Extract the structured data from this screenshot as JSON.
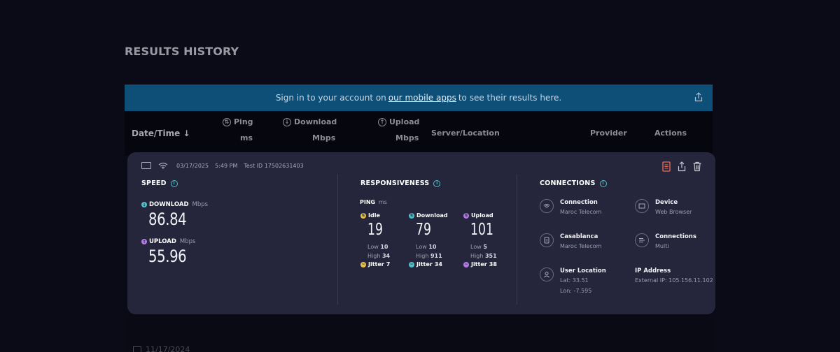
{
  "page": {
    "title": "RESULTS HISTORY"
  },
  "banner": {
    "prefix": "Sign in to your account on",
    "link": "our mobile apps",
    "suffix": "to see their results here.",
    "share_icon": "share-icon"
  },
  "table_header": {
    "date": "Date/Time",
    "ping": "Ping",
    "ping_unit": "ms",
    "download": "Download",
    "download_unit": "Mbps",
    "upload": "Upload",
    "upload_unit": "Mbps",
    "server": "Server/Location",
    "provider": "Provider",
    "actions": "Actions"
  },
  "result": {
    "date": "03/17/2025",
    "time": "5:49 PM",
    "test_id": "Test ID 17502631403",
    "speed": {
      "title": "SPEED",
      "download_label": "DOWNLOAD",
      "download_unit": "Mbps",
      "download_value": "86.84",
      "upload_label": "UPLOAD",
      "upload_unit": "Mbps",
      "upload_value": "55.96"
    },
    "responsiveness": {
      "title": "RESPONSIVENESS",
      "ping_label": "PING",
      "ping_unit": "ms",
      "columns": [
        {
          "label": "Idle",
          "value": "19",
          "low_label": "Low",
          "low": "10",
          "high_label": "High",
          "high": "34",
          "jitter_label": "Jitter",
          "jitter": "7",
          "color": "#e8c14a"
        },
        {
          "label": "Download",
          "value": "79",
          "low_label": "Low",
          "low": "10",
          "high_label": "High",
          "high": "911",
          "jitter_label": "Jitter",
          "jitter": "34",
          "color": "#4ec3c8"
        },
        {
          "label": "Upload",
          "value": "101",
          "low_label": "Low",
          "low": "5",
          "high_label": "High",
          "high": "351",
          "jitter_label": "Jitter",
          "jitter": "38",
          "color": "#b47ae8"
        }
      ]
    },
    "connections": {
      "title": "CONNECTIONS",
      "items": [
        {
          "title": "Connection",
          "sub": "Maroc Telecom",
          "icon": "wifi-icon"
        },
        {
          "title": "Device",
          "sub": "Web Browser",
          "icon": "laptop-icon"
        },
        {
          "title": "Casablanca",
          "sub": "Maroc Telecom",
          "icon": "server-icon"
        },
        {
          "title": "Connections",
          "sub": "Multi",
          "icon": "multi-connection-icon"
        },
        {
          "title": "User Location",
          "sub": "Lat: 33.51",
          "sub2": "Lon: -7.595",
          "icon": "user-icon"
        },
        {
          "title": "IP Address",
          "sub": "External IP: 105.156.11.102"
        }
      ]
    }
  },
  "next_result": {
    "date": "11/17/2024"
  },
  "colors": {
    "background": "#0b0b18",
    "banner": "#0e4f78",
    "card": "#25263c",
    "accent_teal": "#4ec3c8",
    "accent_purple": "#b47ae8",
    "accent_yellow": "#e8c14a",
    "report_icon": "#e8705a"
  }
}
